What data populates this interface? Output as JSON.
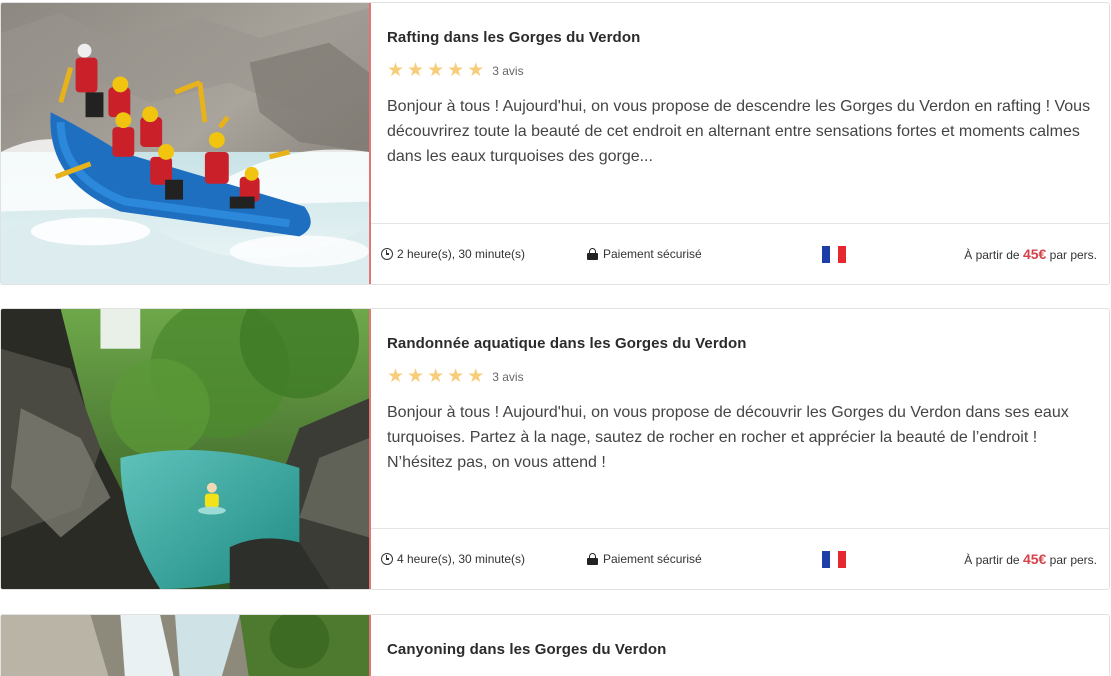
{
  "listings": [
    {
      "image_alt": "rafting-photo",
      "title": "Rafting dans les Gorges du Verdon",
      "rating_stars": 5,
      "reviews": "3 avis",
      "description": "Bonjour à tous ! Aujourd'hui, on vous propose de descendre les Gorges du Verdon en rafting ! Vous découvrirez toute la beauté de cet endroit en alternant entre sensations fortes et moments calmes dans les eaux turquoises des gorge...",
      "duration": "2 heure(s), 30 minute(s)",
      "payment": "Paiement sécurisé",
      "language_flag": "french-flag",
      "price_prefix": "À partir de",
      "price_amount": "45€",
      "price_suffix": "par pers."
    },
    {
      "image_alt": "aquatic-hike-photo",
      "title": "Randonnée aquatique dans les Gorges du Verdon",
      "rating_stars": 5,
      "reviews": "3 avis",
      "description": "Bonjour à tous ! Aujourd'hui, on vous propose de découvrir les Gorges du Verdon dans ses eaux turquoises. Partez à la nage, sautez de rocher en rocher et apprécier la beauté de l’endroit ! N’hésitez pas, on vous attend !",
      "duration": "4 heure(s), 30 minute(s)",
      "payment": "Paiement sécurisé",
      "language_flag": "french-flag",
      "price_prefix": "À partir de",
      "price_amount": "45€",
      "price_suffix": "par pers."
    },
    {
      "image_alt": "canyoning-photo",
      "title": "Canyoning dans les Gorges du Verdon"
    }
  ],
  "colors": {
    "accent_price": "#d6424a",
    "star": "#f8cd7a",
    "photo_border": "#e07676"
  }
}
